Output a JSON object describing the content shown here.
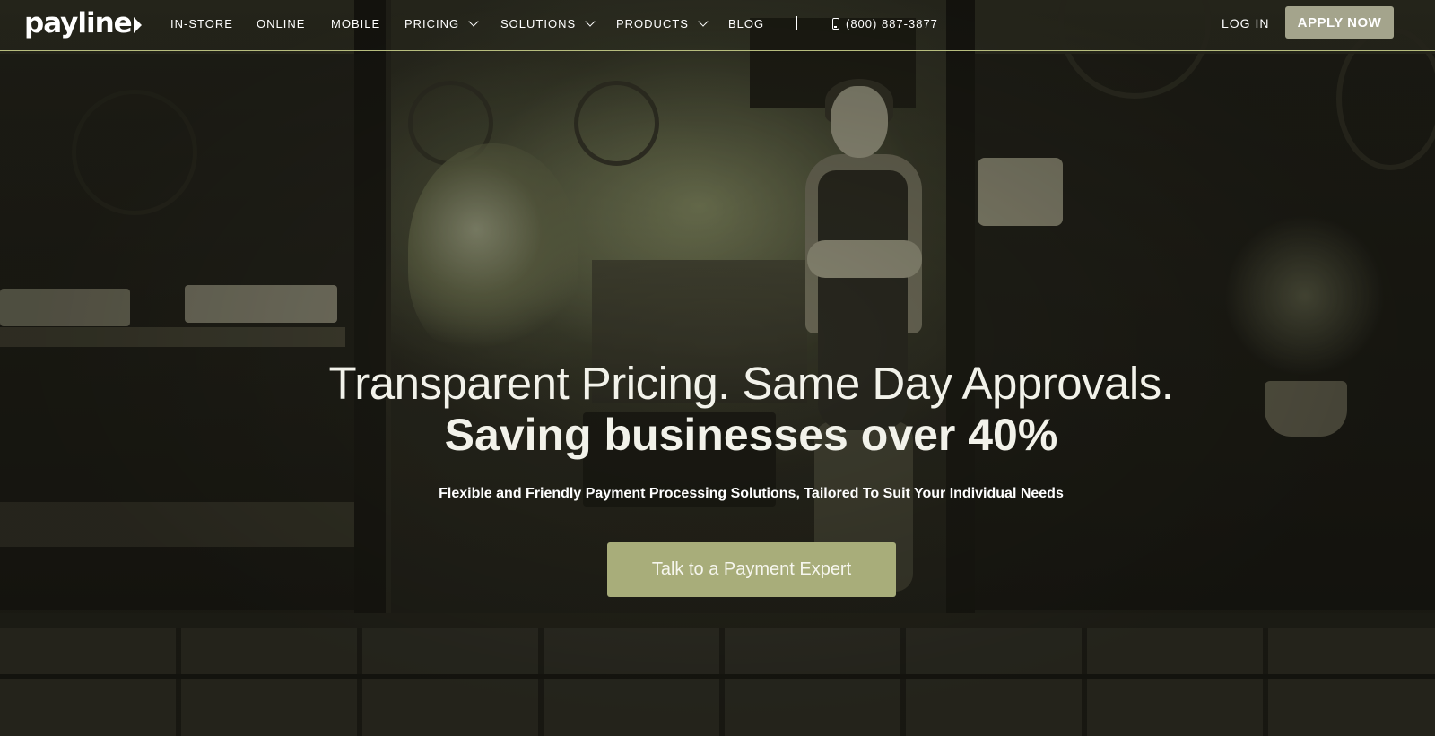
{
  "brand": {
    "logo_text": "payline",
    "accent_color": "#a8ad7a",
    "apply_color": "#a4a48c"
  },
  "nav": {
    "items": [
      {
        "label": "IN-STORE",
        "has_dropdown": false
      },
      {
        "label": "ONLINE",
        "has_dropdown": false
      },
      {
        "label": "MOBILE",
        "has_dropdown": false
      },
      {
        "label": "PRICING",
        "has_dropdown": true
      },
      {
        "label": "SOLUTIONS",
        "has_dropdown": true
      },
      {
        "label": "PRODUCTS",
        "has_dropdown": true
      },
      {
        "label": "BLOG",
        "has_dropdown": false
      }
    ],
    "separator": "|",
    "phone": "(800) 887-3877",
    "phone_icon": "mobile-phone-icon",
    "login_label": "LOG IN",
    "apply_label": "APPLY NOW"
  },
  "hero": {
    "headline_line1": "Transparent Pricing. Same Day Approvals.",
    "headline_line2": "Saving businesses over 40%",
    "subheadline": "Flexible and Friendly Payment Processing Solutions, Tailored To Suit Your Individual Needs",
    "cta_label": "Talk to a Payment Expert"
  }
}
